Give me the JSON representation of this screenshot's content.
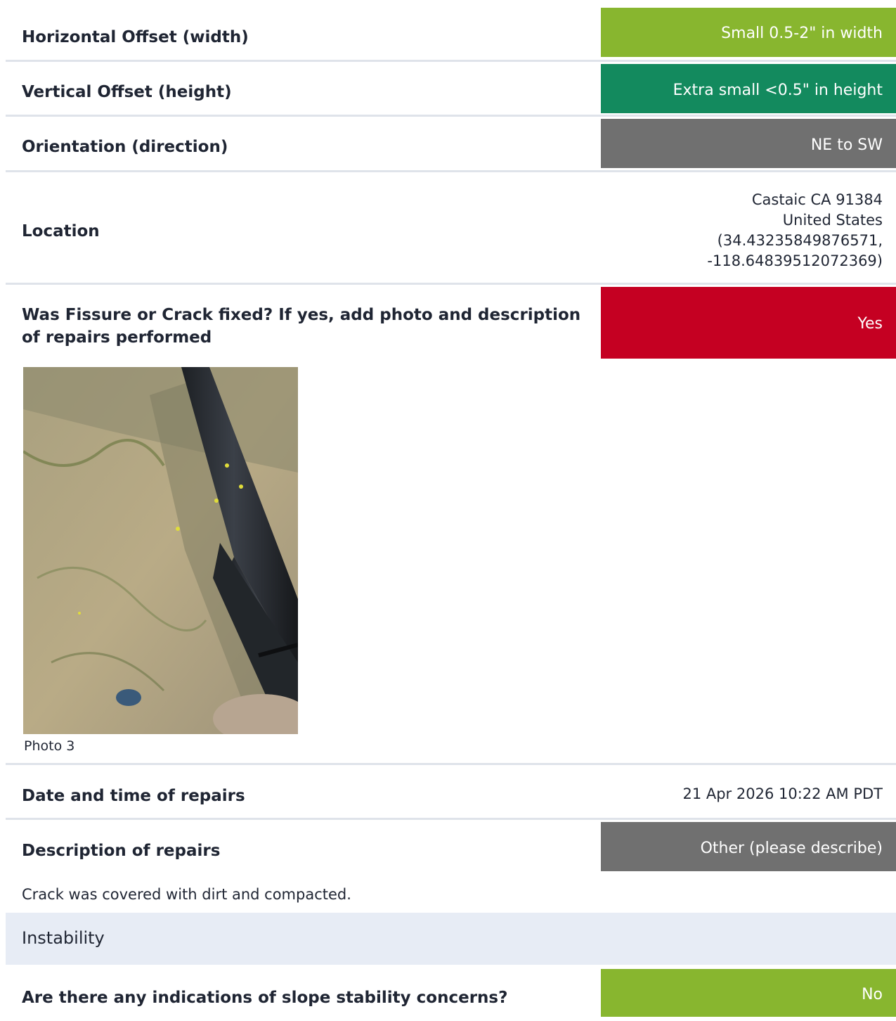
{
  "rows": {
    "horizontal_offset": {
      "label": "Horizontal Offset (width)",
      "value": "Small 0.5-2\" in width",
      "color": "#88b62f"
    },
    "vertical_offset": {
      "label": "Vertical Offset (height)",
      "value": "Extra small <0.5\" in height",
      "color": "#138a5e"
    },
    "orientation": {
      "label": "Orientation (direction)",
      "value": "NE to SW",
      "color": "#707070"
    },
    "location": {
      "label": "Location",
      "line1": "Castaic CA 91384",
      "line2": "United States",
      "line3": "(34.43235849876571,",
      "line4": "-118.64839512072369)"
    },
    "fixed": {
      "label_line1": "Was Fissure or Crack fixed? If yes, add photo and description",
      "label_line2": "of repairs performed",
      "value": "Yes",
      "color": "#c50022"
    },
    "photo": {
      "caption": "Photo 3"
    },
    "repair_datetime": {
      "label": "Date and time of repairs",
      "value": "21 Apr 2026 10:22 AM PDT"
    },
    "repair_description": {
      "label": "Description of repairs",
      "value": "Other (please describe)",
      "color": "#707070",
      "note": "Crack was covered with dirt and compacted."
    }
  },
  "section": {
    "title": "Instability"
  },
  "slope": {
    "label": "Are there any indications of slope stability concerns?",
    "value": "No",
    "color": "#88b62f"
  }
}
